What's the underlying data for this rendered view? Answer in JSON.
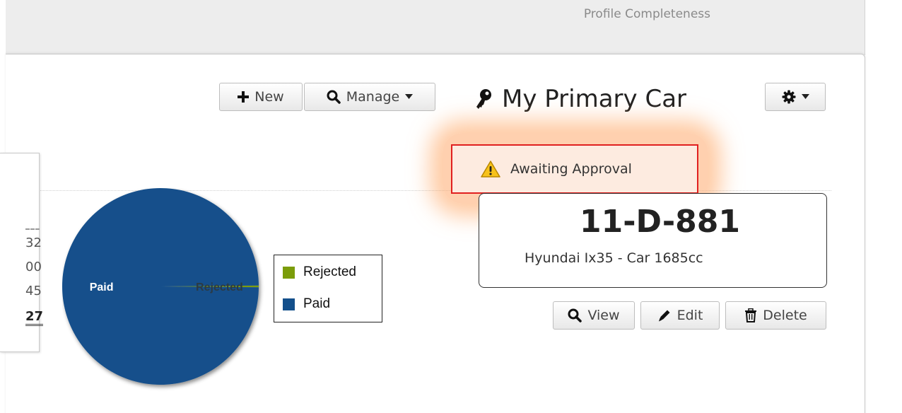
{
  "header": {
    "profile_label": "Profile Completeness"
  },
  "toolbar": {
    "new_label": "New",
    "manage_label": "Manage"
  },
  "vehicle": {
    "title": "My Primary Car",
    "status": "Awaiting Approval",
    "registration": "11-D-881",
    "description": "Hyundai Ix35 - Car 1685cc",
    "actions": {
      "view_label": "View",
      "edit_label": "Edit",
      "delete_label": "Delete"
    }
  },
  "summary_values": [
    "32",
    "00",
    "45",
    "27"
  ],
  "chart_data": {
    "type": "pie",
    "slices": [
      {
        "label": "Rejected",
        "value": 0.3,
        "color": "#7b9c0a"
      },
      {
        "label": "Paid",
        "value": 99.7,
        "color": "#134f8b"
      }
    ],
    "legend": [
      "Rejected",
      "Paid"
    ],
    "legend_position": "right"
  },
  "colors": {
    "accent_red": "#e02020",
    "highlight_orange": "#ffa060",
    "paid_blue": "#134f8b",
    "rejected_green": "#7b9c0a"
  },
  "icons": {
    "new": "plus-icon",
    "manage": "search-icon",
    "title": "key-icon",
    "settings": "gear-icon",
    "status": "warning-icon",
    "view": "search-icon",
    "edit": "pencil-icon",
    "delete": "trash-icon"
  }
}
